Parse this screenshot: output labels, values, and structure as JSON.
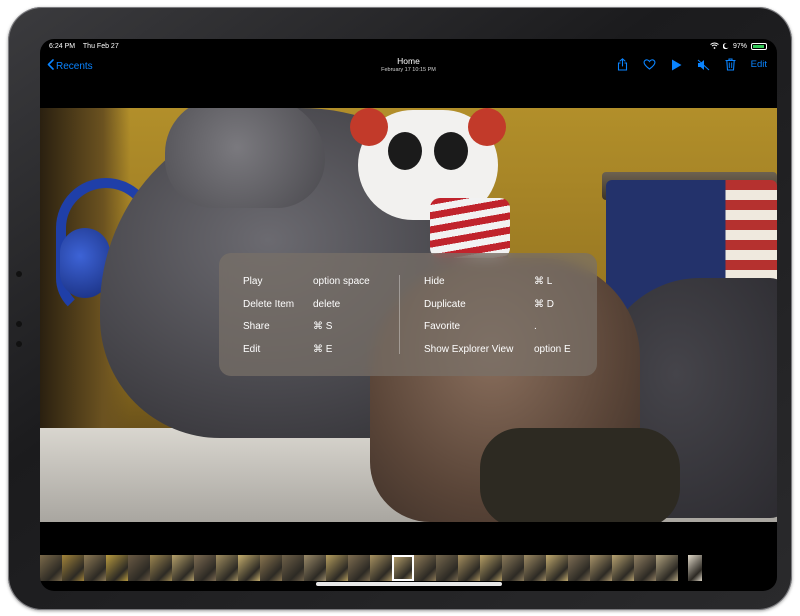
{
  "status_bar": {
    "time": "6:24 PM",
    "date": "Thu Feb 27",
    "battery_percent": "97%"
  },
  "nav": {
    "back_label": "Recents",
    "title": "Home",
    "subtitle": "February 17  10:15 PM",
    "edit_label": "Edit",
    "icons": [
      "share-icon",
      "heart-icon",
      "play-icon",
      "mute-icon",
      "trash-icon"
    ],
    "accent_color": "#0a84ff"
  },
  "shortcuts": {
    "left": [
      {
        "label": "Play",
        "key": "option space"
      },
      {
        "label": "Delete Item",
        "key": "delete"
      },
      {
        "label": "Share",
        "key": "⌘ S"
      },
      {
        "label": "Edit",
        "key": "⌘ E"
      }
    ],
    "right": [
      {
        "label": "Hide",
        "key": "⌘ L"
      },
      {
        "label": "Duplicate",
        "key": "⌘ D"
      },
      {
        "label": "Favorite",
        "key": "."
      },
      {
        "label": "Show Explorer View",
        "key": "option E"
      }
    ]
  },
  "filmstrip": {
    "frame_colors": [
      "#7b6a4a",
      "#a2843a",
      "#8d7a55",
      "#b89a3f",
      "#6a5a44",
      "#9c8650",
      "#b5a06a",
      "#7d6b52",
      "#a08e60",
      "#c4ad6d",
      "#8a7650",
      "#6f6149",
      "#9a8a68",
      "#b49d5e",
      "#7e6d50",
      "#a89261",
      "#c2aa72",
      "#8f7c59",
      "#76684e",
      "#a58f5f",
      "#b69f66",
      "#8a7a5a",
      "#9d8a63",
      "#c0a96e",
      "#7f6f55",
      "#a9946a",
      "#b7a271",
      "#918063",
      "#b0a27f",
      "#e0d8c8"
    ]
  }
}
